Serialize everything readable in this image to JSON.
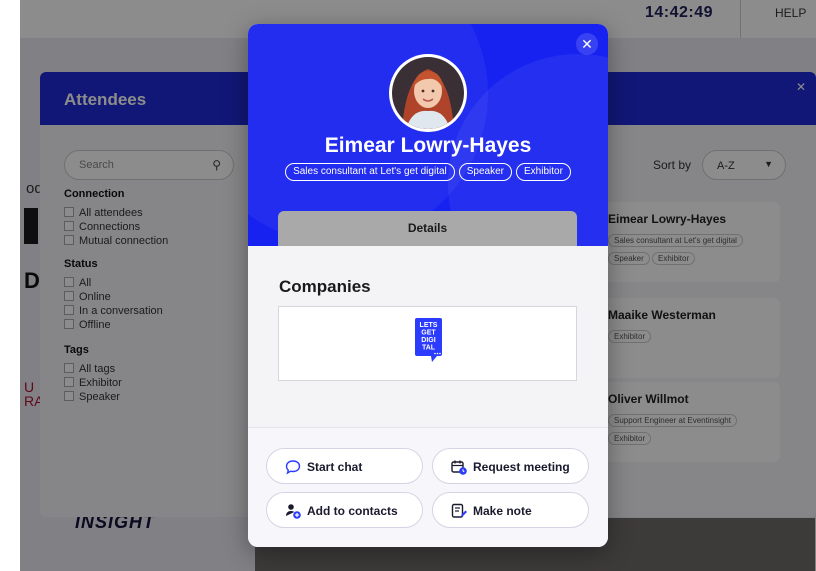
{
  "background": {
    "clock": "14:42:49",
    "help_label": "HELP",
    "left_logo_fragments": [
      "od",
      "LI",
      "Da",
      "U",
      "RA"
    ],
    "brand_logo": "INSIGHT"
  },
  "attendees_panel": {
    "title": "Attendees",
    "search_placeholder": "Search",
    "sort_label": "Sort by",
    "sort_value": "A-Z",
    "filters": [
      {
        "heading": "Connection",
        "options": [
          "All attendees",
          "Connections",
          "Mutual connection"
        ]
      },
      {
        "heading": "Status",
        "options": [
          "All",
          "Online",
          "In a conversation",
          "Offline"
        ]
      },
      {
        "heading": "Tags",
        "options": [
          "All tags",
          "Exhibitor",
          "Speaker"
        ]
      }
    ],
    "cards": [
      {
        "name": "Eimear Lowry-Hayes",
        "role": "Sales consultant at Let's get digital",
        "tags": [
          "Speaker",
          "Exhibitor"
        ]
      },
      {
        "name": "Maaike Westerman",
        "tags": [
          "Exhibitor"
        ]
      },
      {
        "name": "Oliver Willmot",
        "role": "Support Engineer at Eventinsight",
        "tags": [
          "Exhibitor"
        ]
      }
    ]
  },
  "profile": {
    "name": "Eimear Lowry-Hayes",
    "tags": [
      "Sales consultant at Let's get digital",
      "Speaker",
      "Exhibitor"
    ],
    "tab_label": "Details",
    "companies_heading": "Companies",
    "company_logo_text": [
      "LETS",
      "GET",
      "DIGI",
      "TAL"
    ],
    "colors": {
      "hero": "#1722f0",
      "tab": "#a9a9a9",
      "accent": "#2b3cff"
    },
    "actions": [
      {
        "label": "Start chat",
        "icon": "chat-bubble-icon"
      },
      {
        "label": "Request meeting",
        "icon": "calendar-clock-icon"
      },
      {
        "label": "Add to contacts",
        "icon": "add-user-icon"
      },
      {
        "label": "Make note",
        "icon": "note-edit-icon"
      }
    ],
    "close_icon": "close-icon"
  }
}
